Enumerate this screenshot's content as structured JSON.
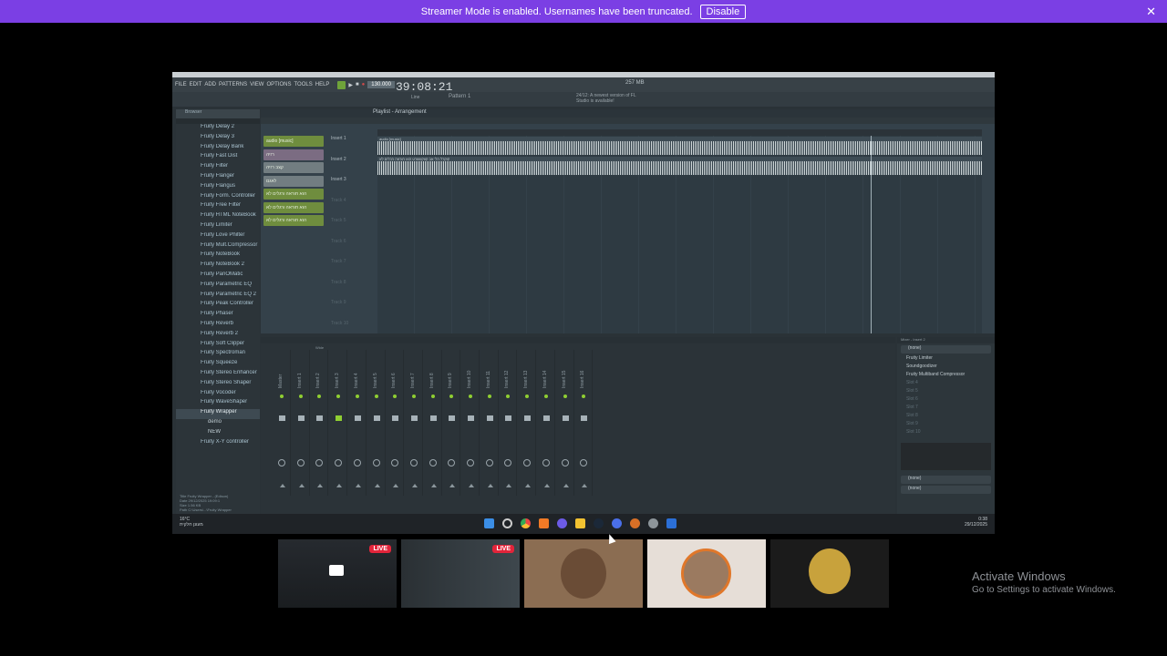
{
  "banner": {
    "text": "Streamer Mode is enabled. Usernames have been truncated.",
    "button": "Disable",
    "close_icon": "close-icon"
  },
  "fl": {
    "menu": [
      "FILE",
      "EDIT",
      "ADD",
      "PATTERNS",
      "VIEW",
      "OPTIONS",
      "TOOLS",
      "HELP"
    ],
    "clock": "39:08:21",
    "tempo": "130.000",
    "pattern": "Pattern 1",
    "snap": "Line",
    "cpu": "257 MB",
    "news": "24/12: A newest version of FL Studio is available!"
  },
  "browser": {
    "title": "Browser",
    "items": [
      "Fruity Delay 2",
      "Fruity Delay 3",
      "Fruity Delay Bank",
      "Fruity Fast Dist",
      "Fruity Filter",
      "Fruity Flanger",
      "Fruity Flangus",
      "Fruity Form. Controller",
      "Fruity Free Filter",
      "Fruity HTML NoteBook",
      "Fruity Limiter",
      "Fruity Love Philter",
      "Fruity Mult.Compressor",
      "Fruity NoteBook",
      "Fruity NoteBook 2",
      "Fruity PanOMatic",
      "Fruity Parametric EQ",
      "Fruity Parametric EQ 2",
      "Fruity Peak Controller",
      "Fruity Phaser",
      "Fruity Reverb",
      "Fruity Reverb 2",
      "Fruity Soft Clipper",
      "Fruity Spectroman",
      "Fruity Squeeze",
      "Fruity Stereo Enhancer",
      "Fruity Stereo Shaper",
      "Fruity Vocoder",
      "Fruity WaveShaper",
      "Fruity Wrapper"
    ],
    "subitems": [
      "demo",
      "NEW"
    ],
    "last": "Fruity X-Y controller",
    "info": [
      "Title   Fruity Wrapper - (Edison)",
      "Date    29/12/2025 19:09:1",
      "Size    1.56 KB",
      "Path    C:\\Users\\...\\Fruity Wrapper"
    ],
    "tags_label": "TAGS"
  },
  "playlist": {
    "title": "Playlist - Arrangement",
    "patterns": [
      {
        "label": "audio [music]",
        "style": "green"
      },
      {
        "label": "רזיה",
        "style": "purple"
      },
      {
        "label": "קצב רזיה",
        "style": "gray"
      },
      {
        "label": "לאגם",
        "style": "gray"
      },
      {
        "label": "הוא חוראה ורגלים לא",
        "style": "green"
      },
      {
        "label": "הוא חוראה ורגלים לא",
        "style": "green"
      },
      {
        "label": "הוא חוראה ורגלים לא",
        "style": "green"
      }
    ],
    "tracks": [
      "Insert 1",
      "Insert 2",
      "Insert 3",
      "Track 4",
      "Track 5",
      "Track 6",
      "Track 7",
      "Track 8",
      "Track 9",
      "Track 10"
    ],
    "clips": [
      "audio [music]",
      "קוקרל הל' אב קוזקוזשרט הוא חוראה הכלים לא"
    ]
  },
  "mixer": {
    "title": "Wide",
    "strips": [
      "Master",
      "Insert 1",
      "Insert 2",
      "Insert 3",
      "Insert 4",
      "Insert 5",
      "Insert 6",
      "Insert 7",
      "Insert 8",
      "Insert 9",
      "Insert 10",
      "Insert 11",
      "Insert 12",
      "Insert 13",
      "Insert 14",
      "Insert 15",
      "Insert 16"
    ],
    "fx_title": "Mixer - Insert 2",
    "fx_none": "(none)",
    "fx_slots": [
      "Fruity Limiter",
      "Soundgoodizer",
      "Fruity Multiband Compressor",
      "Slot 4",
      "Slot 5",
      "Slot 6",
      "Slot 7",
      "Slot 8",
      "Slot 9",
      "Slot 10"
    ],
    "fx_out": [
      "(none)",
      "(none)"
    ]
  },
  "taskbar": {
    "temp": "16°C",
    "weather": "מעונן חלקית",
    "time": "0:38",
    "date": "29/12/2025"
  },
  "thumbs": [
    {
      "live": "LIVE"
    },
    {
      "live": "LIVE"
    },
    {},
    {},
    {}
  ],
  "activate": {
    "title": "Activate Windows",
    "sub": "Go to Settings to activate Windows."
  },
  "colors": {
    "banner": "#7b3fe4",
    "live": "#e2243a",
    "fl_green": "#8fcf32"
  }
}
